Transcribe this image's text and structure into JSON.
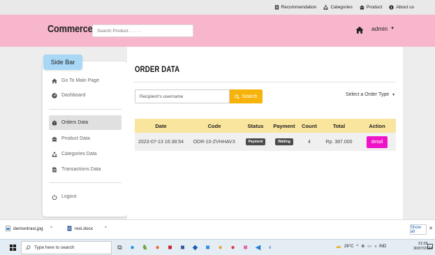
{
  "topbar": {
    "links": [
      {
        "icon": "clipboard-icon",
        "label": "Recommendation"
      },
      {
        "icon": "people-icon",
        "label": "Categories"
      },
      {
        "icon": "product-icon",
        "label": "Product"
      },
      {
        "icon": "info-icon",
        "label": "About us"
      }
    ]
  },
  "nav": {
    "brand": "Commerce",
    "search_placeholder": "Search Product . . . . .",
    "admin_label": "admin"
  },
  "sidebar": {
    "title": "Side Bar",
    "items": [
      {
        "icon": "home-icon",
        "label": "Go To Main Page"
      },
      {
        "icon": "dashboard-icon",
        "label": "Dashboard"
      },
      {
        "icon": "orders-icon",
        "label": "Orders Data",
        "active": true
      },
      {
        "icon": "product-icon",
        "label": "Product Data"
      },
      {
        "icon": "categories-icon",
        "label": "Categories Data"
      },
      {
        "icon": "transactions-icon",
        "label": "Transactions Data"
      },
      {
        "icon": "power-icon",
        "label": "Logout"
      }
    ]
  },
  "main": {
    "title": "ORDER DATA",
    "username_placeholder": "Recipient's username",
    "search_label": "Search",
    "order_type_label": "Select a Order Type",
    "table": {
      "headers": [
        "Date",
        "Code",
        "Status",
        "Payment",
        "Count",
        "Total",
        "Action"
      ],
      "rows": [
        {
          "date": "2023-07-13 16:38:54",
          "code": "ODR-10-ZVHHAVX",
          "status": "Payment",
          "payment": "Waiting",
          "count": "4",
          "total": "Rp. 387.000",
          "action": "detail"
        }
      ]
    }
  },
  "downloads": {
    "items": [
      "demontrasi.jpg",
      "rexi.docx"
    ],
    "show_all": "Show all"
  },
  "taskbar": {
    "search_placeholder": "Type here to search",
    "temperature": "26°C",
    "language": "IND",
    "time": "21:06",
    "date": "30/07/2023"
  },
  "colors": {
    "nav_bg": "#f8b6cd",
    "sidebar_title_bg": "#a9d8f7",
    "search_button": "#f6b30b",
    "table_header": "#f9e59e",
    "detail_button": "#f012c8"
  }
}
